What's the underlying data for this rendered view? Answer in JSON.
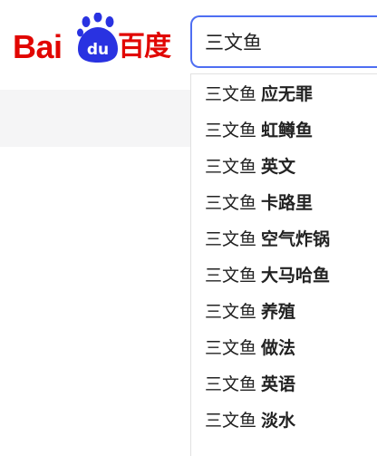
{
  "brand": {
    "latin": "Bai",
    "paw_text": "du",
    "chinese": "百度",
    "logo_color": "#e10602",
    "paw_color": "#2932e1"
  },
  "search": {
    "value": "三文鱼",
    "border_color": "#4e6ef2"
  },
  "suggestions": [
    {
      "query": "三文鱼",
      "completion": "应无罪"
    },
    {
      "query": "三文鱼",
      "completion": "虹鳟鱼"
    },
    {
      "query": "三文鱼",
      "completion": "英文"
    },
    {
      "query": "三文鱼",
      "completion": "卡路里"
    },
    {
      "query": "三文鱼",
      "completion": "空气炸锅"
    },
    {
      "query": "三文鱼",
      "completion": "大马哈鱼"
    },
    {
      "query": "三文鱼",
      "completion": "养殖"
    },
    {
      "query": "三文鱼",
      "completion": "做法"
    },
    {
      "query": "三文鱼",
      "completion": "英语"
    },
    {
      "query": "三文鱼",
      "completion": "淡水"
    }
  ]
}
